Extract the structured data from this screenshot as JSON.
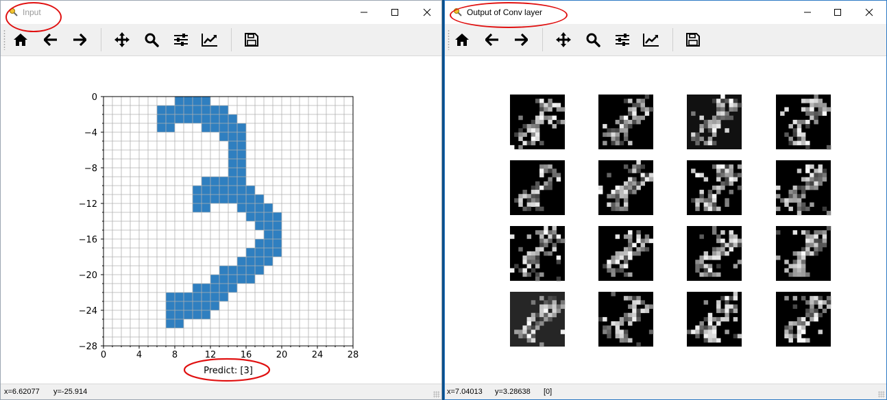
{
  "input_window": {
    "title": "Input",
    "toolbar": {
      "home": "home-icon",
      "back": "arrow-left-icon",
      "forward": "arrow-right-icon",
      "pan": "move-icon",
      "zoom": "search-icon",
      "configure": "sliders-icon",
      "edit": "line-chart-icon",
      "save": "save-icon"
    },
    "status": {
      "x": "x=6.62077",
      "y": "y=-25.914"
    },
    "chart_data": {
      "type": "heatmap",
      "title": "",
      "xlabel": "Predict: [3]",
      "ylabel": "",
      "xlim": [
        0,
        28
      ],
      "ylim": [
        -28,
        0
      ],
      "xticks": [
        "0",
        "4",
        "8",
        "12",
        "16",
        "20",
        "24",
        "28"
      ],
      "yticks": [
        "0",
        "−4",
        "−8",
        "−12",
        "−16",
        "−20",
        "−24",
        "−28"
      ],
      "grid": true,
      "fill_color": "#2f7fc0",
      "rows": [
        {
          "row": 0,
          "cols": [
            [
              8,
              12
            ]
          ]
        },
        {
          "row": 1,
          "cols": [
            [
              6,
              14
            ]
          ]
        },
        {
          "row": 2,
          "cols": [
            [
              6,
              15
            ]
          ]
        },
        {
          "row": 3,
          "cols": [
            [
              6,
              8
            ],
            [
              11,
              16
            ]
          ]
        },
        {
          "row": 4,
          "cols": [
            [
              13,
              16
            ]
          ]
        },
        {
          "row": 5,
          "cols": [
            [
              14,
              16
            ]
          ]
        },
        {
          "row": 6,
          "cols": [
            [
              14,
              16
            ]
          ]
        },
        {
          "row": 7,
          "cols": [
            [
              14,
              16
            ]
          ]
        },
        {
          "row": 8,
          "cols": [
            [
              14,
              16
            ]
          ]
        },
        {
          "row": 9,
          "cols": [
            [
              11,
              16
            ]
          ]
        },
        {
          "row": 10,
          "cols": [
            [
              10,
              17
            ]
          ]
        },
        {
          "row": 11,
          "cols": [
            [
              10,
              18
            ]
          ]
        },
        {
          "row": 12,
          "cols": [
            [
              10,
              12
            ],
            [
              15,
              19
            ]
          ]
        },
        {
          "row": 13,
          "cols": [
            [
              16,
              20
            ]
          ]
        },
        {
          "row": 14,
          "cols": [
            [
              17,
              20
            ]
          ]
        },
        {
          "row": 15,
          "cols": [
            [
              18,
              20
            ]
          ]
        },
        {
          "row": 16,
          "cols": [
            [
              17,
              20
            ]
          ]
        },
        {
          "row": 17,
          "cols": [
            [
              16,
              20
            ]
          ]
        },
        {
          "row": 18,
          "cols": [
            [
              15,
              19
            ]
          ]
        },
        {
          "row": 19,
          "cols": [
            [
              13,
              18
            ]
          ]
        },
        {
          "row": 20,
          "cols": [
            [
              12,
              17
            ]
          ]
        },
        {
          "row": 21,
          "cols": [
            [
              10,
              15
            ]
          ]
        },
        {
          "row": 22,
          "cols": [
            [
              7,
              14
            ]
          ]
        },
        {
          "row": 23,
          "cols": [
            [
              7,
              13
            ]
          ]
        },
        {
          "row": 24,
          "cols": [
            [
              7,
              12
            ]
          ]
        },
        {
          "row": 25,
          "cols": [
            [
              7,
              9
            ]
          ]
        }
      ]
    },
    "annotation_color": "#e01010"
  },
  "conv_window": {
    "title": "Output of Conv layer",
    "toolbar": {
      "home": "home-icon",
      "back": "arrow-left-icon",
      "forward": "arrow-right-icon",
      "pan": "move-icon",
      "zoom": "search-icon",
      "configure": "sliders-icon",
      "edit": "line-chart-icon",
      "save": "save-icon"
    },
    "status": {
      "x": "x=7.04013",
      "y": "y=3.28638",
      "value": "[0]"
    },
    "feature_maps": {
      "rows": 4,
      "cols": 4,
      "count": 16,
      "colormap": "gray",
      "grid_size": 13
    }
  }
}
